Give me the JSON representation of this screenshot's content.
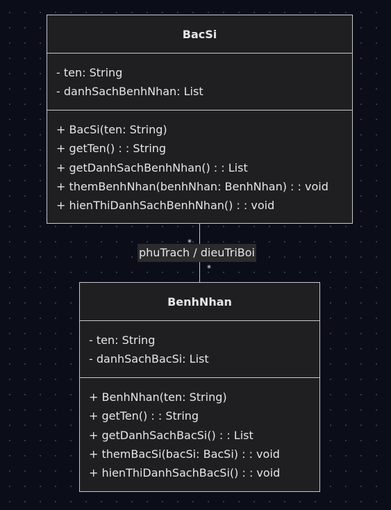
{
  "classes": {
    "bacsi": {
      "name": "BacSi",
      "attributes": [
        "- ten: String",
        "- danhSachBenhNhan: List"
      ],
      "methods": [
        "+ BacSi(ten: String)",
        "+ getTen() : : String",
        "+ getDanhSachBenhNhan() : : List",
        "+ themBenhNhan(benhNhan: BenhNhan) : : void",
        "+ hienThiDanhSachBenhNhan() : : void"
      ]
    },
    "benhnhan": {
      "name": "BenhNhan",
      "attributes": [
        "- ten: String",
        "- danhSachBacSi: List"
      ],
      "methods": [
        "+ BenhNhan(ten: String)",
        "+ getTen() : : String",
        "+ getDanhSachBacSi() : : List",
        "+ themBacSi(bacSi: BacSi) : : void",
        "+ hienThiDanhSachBacSi() : : void"
      ]
    }
  },
  "association": {
    "label": "phuTrach / dieuTriBoi",
    "source_multiplicity": "*",
    "target_multiplicity": "*"
  },
  "colors": {
    "background": "#0b0d19",
    "class_fill": "#1f1f21",
    "class_border": "#c9c9c9",
    "text": "#e6e6e6",
    "label_fill": "#2b2b2d"
  }
}
